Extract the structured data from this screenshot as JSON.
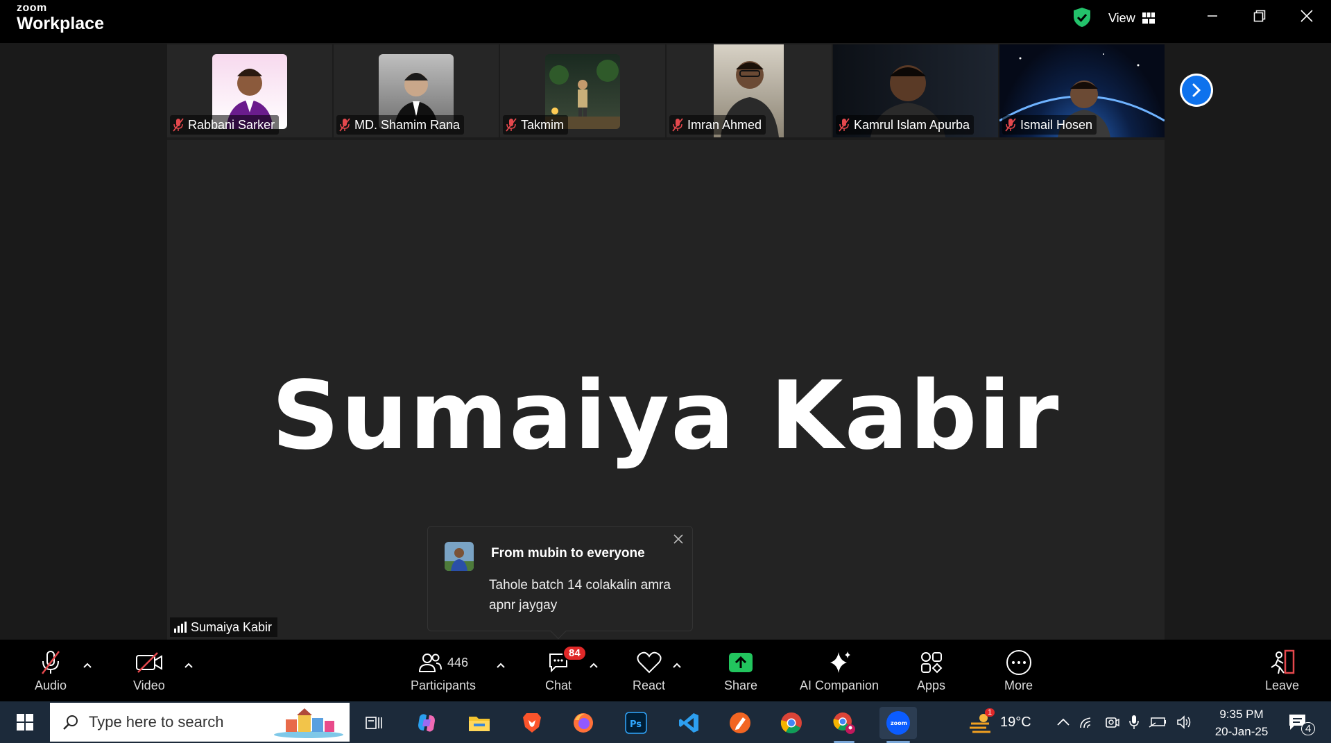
{
  "app": {
    "brand_top": "zoom",
    "brand_bottom": "Workplace",
    "view_label": "View"
  },
  "participants_strip": [
    {
      "name": "Rabbani Sarker"
    },
    {
      "name": "MD. Shamim Rana"
    },
    {
      "name": "Takmim"
    },
    {
      "name": "Imran Ahmed"
    },
    {
      "name": "Kamrul Islam Apurba"
    },
    {
      "name": "Ismail Hosen"
    }
  ],
  "main_video": {
    "display_name": "Sumaiya Kabir",
    "speaker_tag": "Sumaiya Kabir"
  },
  "chat_popup": {
    "title": "From mubin to everyone",
    "message": "Tahole batch 14 colakalin amra apnr jaygay"
  },
  "toolbar": {
    "audio": "Audio",
    "video": "Video",
    "participants": "Participants",
    "participant_count": "446",
    "chat": "Chat",
    "chat_badge": "84",
    "react": "React",
    "share": "Share",
    "ai_companion": "AI Companion",
    "apps": "Apps",
    "more": "More",
    "leave": "Leave"
  },
  "taskbar": {
    "search_placeholder": "Type here to search",
    "weather_temp": "19°C",
    "weather_badge": "1",
    "time": "9:35 PM",
    "date": "20-Jan-25",
    "notification_count": "4"
  },
  "colors": {
    "accent_blue": "#0e72ed",
    "share_green": "#22c55e",
    "mute_red": "#e5484d",
    "badge_red": "#e02828"
  }
}
